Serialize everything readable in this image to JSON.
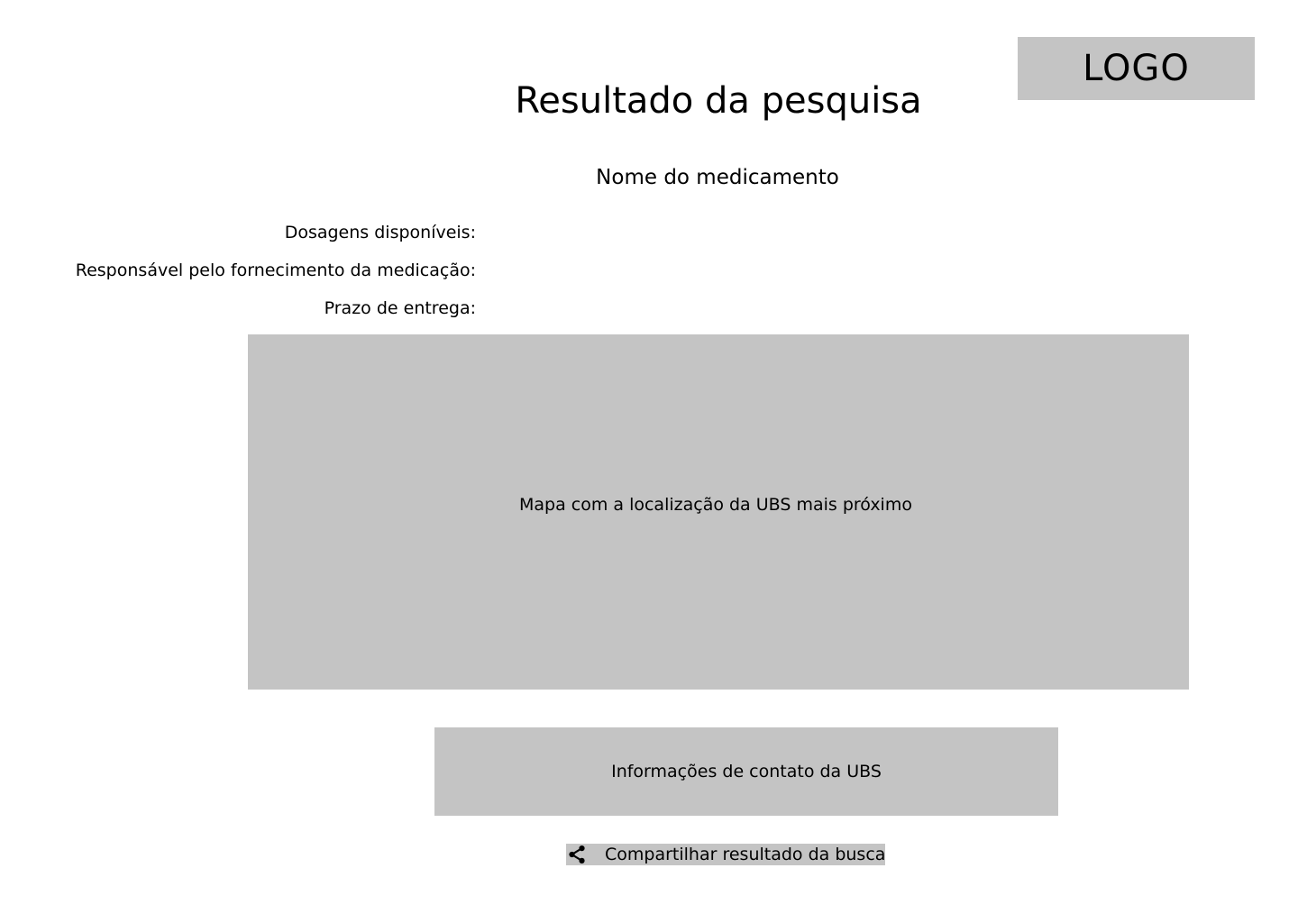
{
  "header": {
    "logo_text": "LOGO",
    "title": "Resultado da pesquisa"
  },
  "medication": {
    "name": "Nome do medicamento",
    "labels": {
      "dosages": "Dosagens disponíveis:",
      "supplier": "Responsável pelo fornecimento da medicação:",
      "delivery": "Prazo de entrega:"
    }
  },
  "map": {
    "label": "Mapa com a localização da UBS mais próximo"
  },
  "contact": {
    "label": "Informações de contato da UBS"
  },
  "share": {
    "icon": "share-icon",
    "label": "Compartilhar resultado da busca"
  },
  "colors": {
    "placeholder_gray": "#c4c4c4",
    "text": "#000000",
    "background": "#ffffff"
  }
}
